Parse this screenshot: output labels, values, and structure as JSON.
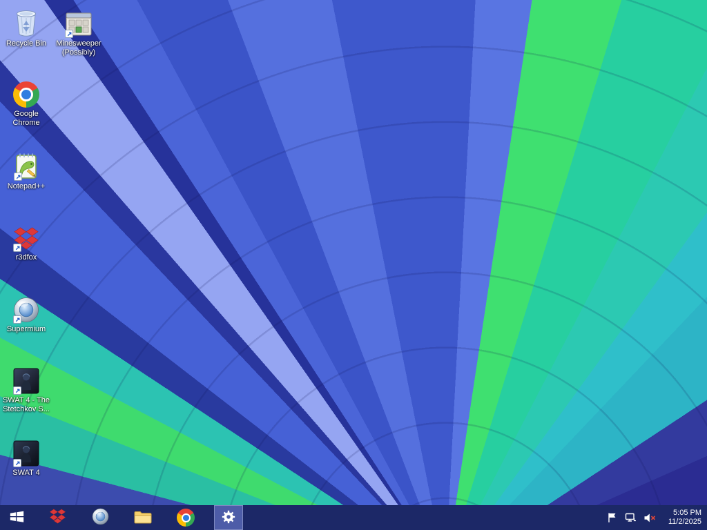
{
  "theme": {
    "taskbar_bg": "#1c2867",
    "taskbar_active_bg": "#4d5ca8",
    "icon_label_color": "#ffffff"
  },
  "wallpaper": {
    "palette": [
      "#4661d6",
      "#5570de",
      "#95a5f2",
      "#3fe070",
      "#2cc3b2",
      "#2fbfca",
      "#2b2c92",
      "#293a9f"
    ]
  },
  "desktop": {
    "icons": [
      {
        "label": "Recycle Bin",
        "icon": "recycle-bin"
      },
      {
        "label": "Minesweeper (Possibly)",
        "icon": "minesweeper-window"
      },
      {
        "label": "Google Chrome",
        "icon": "google-chrome"
      },
      {
        "label": "Notepad++",
        "icon": "notepad-plus-plus"
      },
      {
        "label": "r3dfox",
        "icon": "r3dfox-red-diamonds"
      },
      {
        "label": "Supermium",
        "icon": "supermium-globe"
      },
      {
        "label": "SWAT 4 - The Stetchkov S...",
        "icon": "swat4-expansion"
      },
      {
        "label": "SWAT 4",
        "icon": "swat4"
      }
    ]
  },
  "taskbar": {
    "buttons": [
      {
        "icon": "windows-start"
      },
      {
        "icon": "r3dfox-red-diamonds"
      },
      {
        "icon": "supermium-globe"
      },
      {
        "icon": "file-explorer-folder"
      },
      {
        "icon": "google-chrome"
      },
      {
        "icon": "settings-gear",
        "active": true
      }
    ],
    "tray": {
      "icons": [
        "action-center-flag",
        "wired-network",
        "volume-muted"
      ],
      "time": "5:05 PM",
      "date": "11/2/2025"
    }
  }
}
